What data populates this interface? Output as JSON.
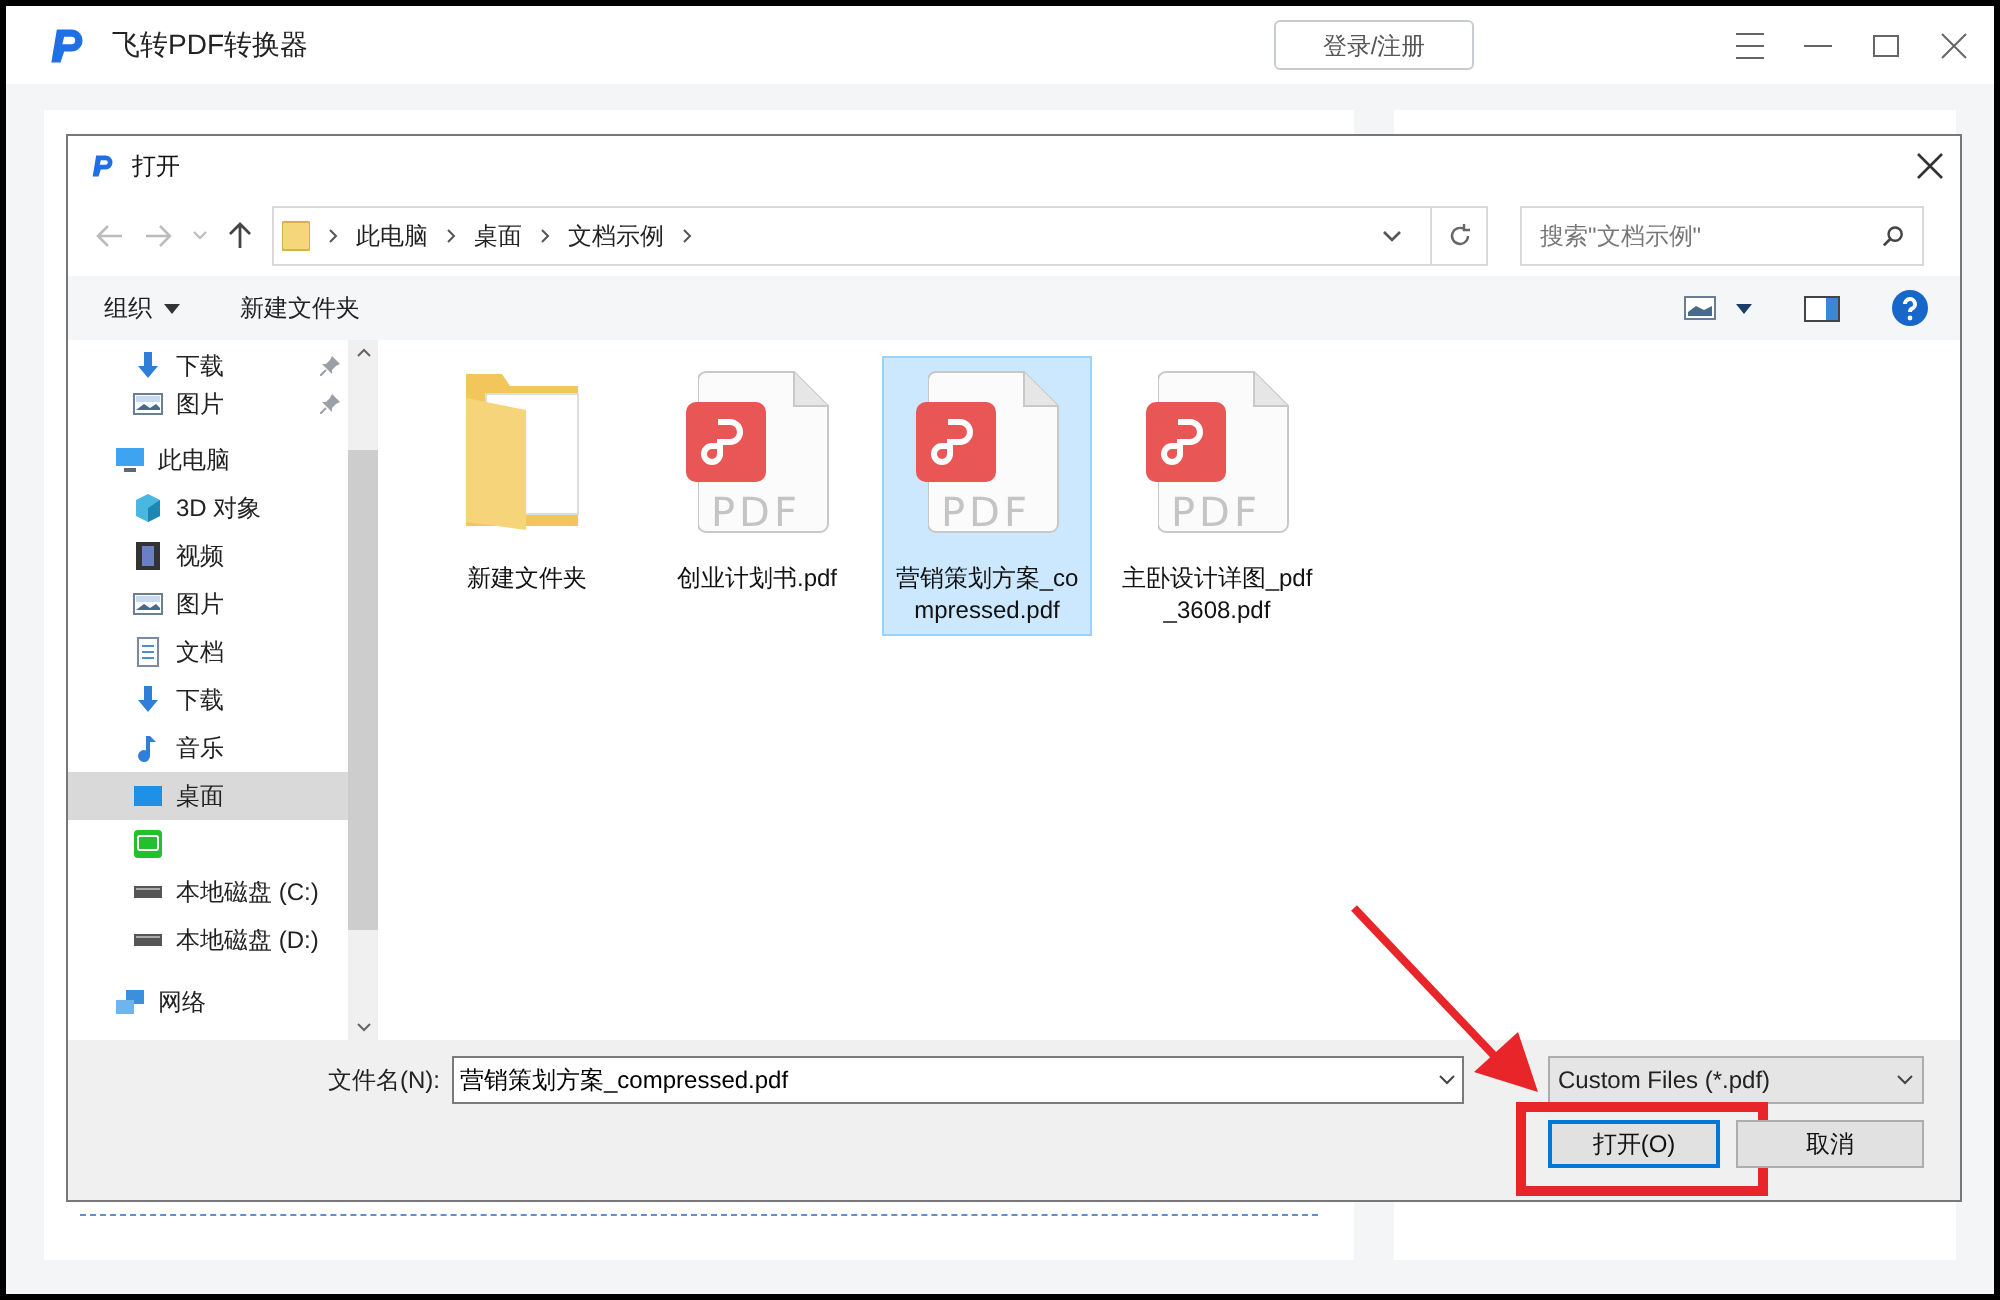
{
  "app": {
    "title": "飞转PDF转换器",
    "login_button": "登录/注册"
  },
  "dialog": {
    "title": "打开",
    "address_path": [
      "此电脑",
      "桌面",
      "文档示例"
    ],
    "search": {
      "placeholder": "搜索\"文档示例\""
    },
    "toolbar": {
      "organize": "组织",
      "new_folder": "新建文件夹"
    },
    "quick_items": [
      {
        "label": "下载",
        "kind": "download",
        "pinned": true,
        "selected": false
      },
      {
        "label": "图片",
        "kind": "picture",
        "pinned": true,
        "selected": false
      }
    ],
    "nav_tree": [
      {
        "label": "此电脑",
        "kind": "pc",
        "selected": false,
        "children": [
          {
            "label": "3D 对象",
            "kind": "cube",
            "selected": false
          },
          {
            "label": "视频",
            "kind": "video",
            "selected": false
          },
          {
            "label": "图片",
            "kind": "picture",
            "selected": false
          },
          {
            "label": "文档",
            "kind": "doc",
            "selected": false
          },
          {
            "label": "下载",
            "kind": "download",
            "selected": false
          },
          {
            "label": "音乐",
            "kind": "music",
            "selected": false
          },
          {
            "label": "桌面",
            "kind": "desktop",
            "selected": true
          },
          {
            "kind": "app",
            "selected": false
          },
          {
            "label": "本地磁盘 (C:)",
            "kind": "drive",
            "selected": false
          },
          {
            "label": "本地磁盘 (D:)",
            "kind": "drive",
            "selected": false
          }
        ]
      },
      {
        "label": "网络",
        "kind": "network",
        "selected": false
      }
    ],
    "files": [
      {
        "name": "新建文件夹",
        "kind": "folder",
        "selected": false
      },
      {
        "name": "创业计划书.pdf",
        "kind": "pdf",
        "badge": "PDF",
        "selected": false
      },
      {
        "name": "营销策划方案_compressed.pdf",
        "kind": "pdf",
        "badge": "PDF",
        "selected": true
      },
      {
        "name": "主卧设计详图_pdf_3608.pdf",
        "kind": "pdf",
        "badge": "PDF",
        "selected": false
      }
    ],
    "file_name": {
      "label": "文件名(N):",
      "value": "营销策划方案_compressed.pdf"
    },
    "file_type": "Custom Files (*.pdf)",
    "buttons": [
      {
        "label": "打开(O)",
        "kind": "primary",
        "highlighted": true
      },
      {
        "label": "取消",
        "kind": "normal",
        "highlighted": false
      }
    ]
  }
}
